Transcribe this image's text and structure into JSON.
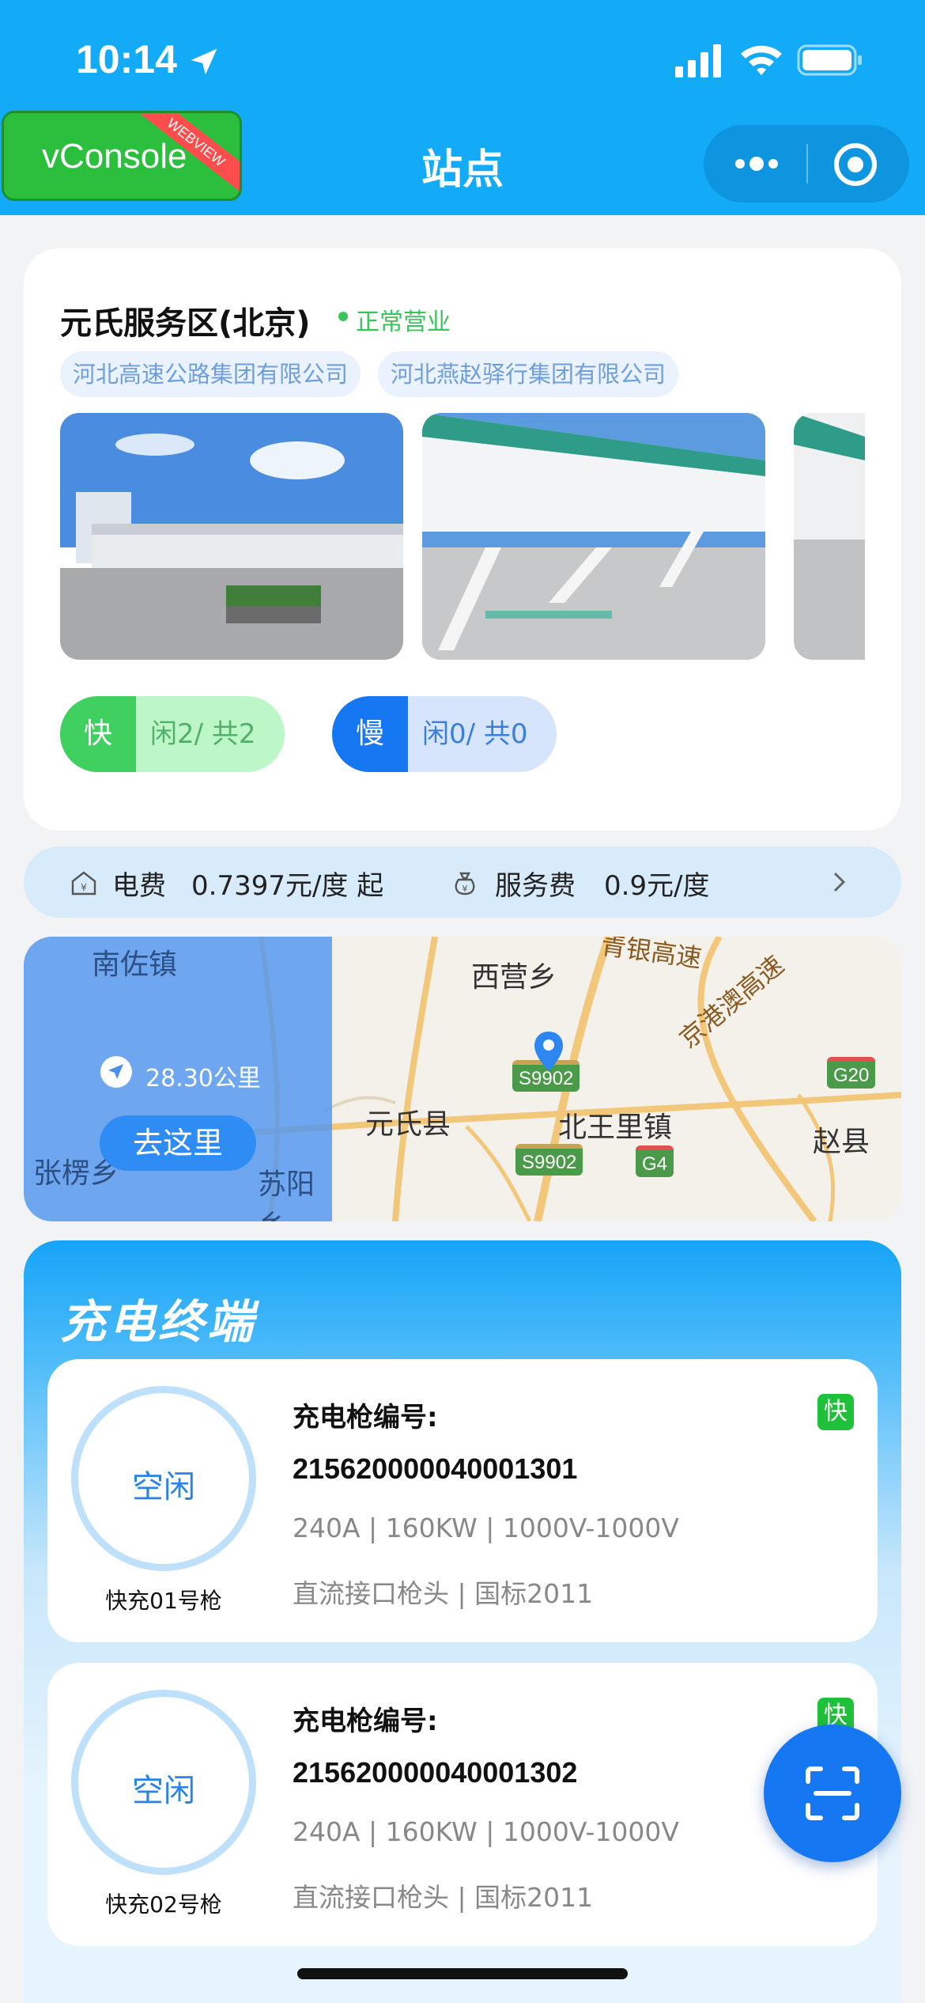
{
  "status_bar": {
    "time": "10:14"
  },
  "header": {
    "title": "站点",
    "vconsole_label": "vConsole",
    "vconsole_ribbon": "WEBVIEW"
  },
  "station": {
    "name": "元氏服务区(北京)",
    "status": "正常营业",
    "operators": [
      "河北高速公路集团有限公司",
      "河北燕赵驿行集团有限公司"
    ],
    "fast": {
      "label": "快",
      "count": "闲2/ 共2"
    },
    "slow": {
      "label": "慢",
      "count": "闲0/ 共0"
    }
  },
  "price": {
    "electricity_label": "电费",
    "electricity_value": "0.7397元/度 起",
    "service_label": "服务费",
    "service_value": "0.9元/度"
  },
  "map": {
    "distance": "28.30公里",
    "goto_label": "去这里",
    "place_labels": [
      "南佐镇",
      "西营乡",
      "元氏县",
      "北王里镇",
      "赵县",
      "张楞乡",
      "苏阳乡",
      "青银高速",
      "京港澳高速"
    ],
    "road_signs": [
      "S9902",
      "S9902",
      "G4",
      "G20"
    ]
  },
  "terminals": {
    "title": "充电终端",
    "guns": [
      {
        "status": "空闲",
        "name": "快充01号枪",
        "code_label": "充电枪编号:",
        "code": "215620000040001301",
        "spec": "240A | 160KW | 1000V-1000V",
        "connector": "直流接口枪头 | 国标2011",
        "badge": "快"
      },
      {
        "status": "空闲",
        "name": "快充02号枪",
        "code_label": "充电枪编号:",
        "code": "215620000040001302",
        "spec": "240A | 160KW | 1000V-1000V",
        "connector": "直流接口枪头 | 国标2011",
        "badge": "快"
      }
    ]
  },
  "colors": {
    "header_bg": "#13aaf8",
    "accent_blue": "#1677f2",
    "fast_green": "#3cc45c",
    "slow_blue": "#1677f2"
  }
}
